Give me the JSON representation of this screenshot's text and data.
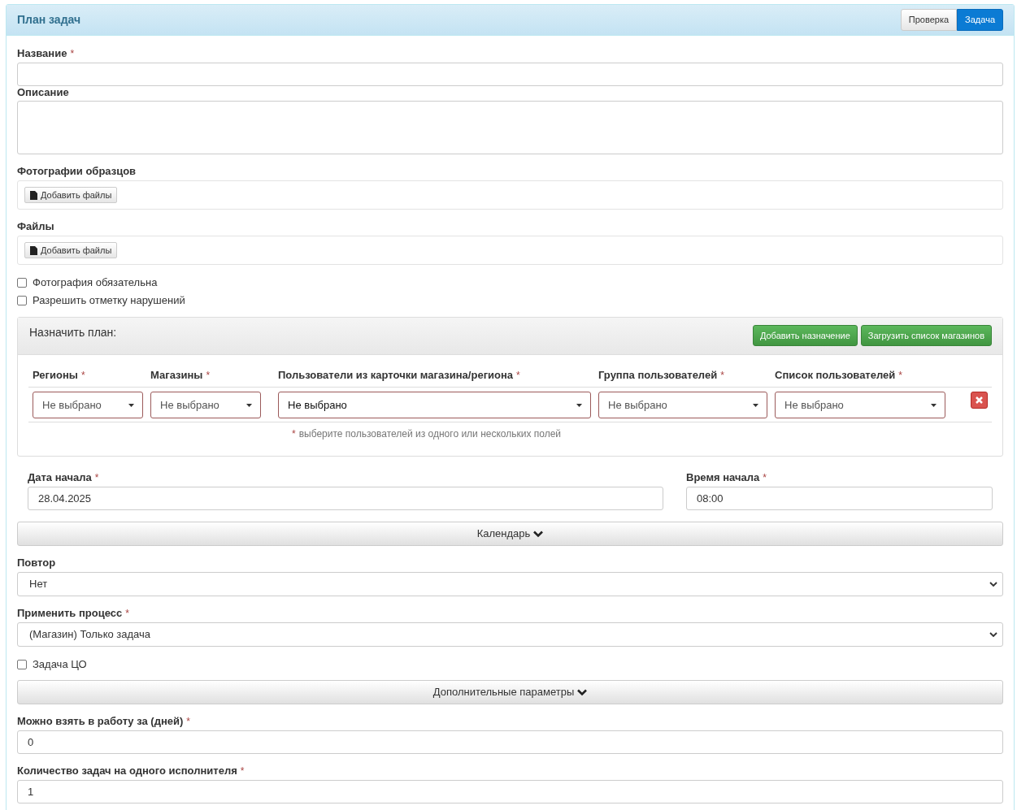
{
  "panel": {
    "title": "План задач",
    "tabs": [
      {
        "label": "Проверка",
        "selected": false
      },
      {
        "label": "Задача",
        "selected": true
      }
    ]
  },
  "sections": [
    {
      "kind": "text",
      "label": "Название",
      "mark": "*"
    },
    {
      "kind": "textarea",
      "label": "Описание"
    },
    {
      "kind": "files",
      "label": "Фотографии образцов",
      "button": "Добавить файлы"
    },
    {
      "kind": "files",
      "label": "Файлы",
      "button": "Добавить файлы"
    },
    {
      "kind": "checkbox",
      "label": "Фотография обязательна",
      "checked": false
    },
    {
      "kind": "checkbox",
      "label": "Разрешить отметку нарушений",
      "checked": false
    },
    {
      "kind": "plan",
      "title": "Назначить план:",
      "buttons": [
        "Добавить назначение",
        "Загрузить список магазинов"
      ],
      "columns": [
        {
          "label": "Регионы",
          "mark": "*"
        },
        {
          "label": "Магазины",
          "mark": "*"
        },
        {
          "label": "Пользователи из карточки магазина/региона",
          "mark": "*"
        },
        {
          "label": "Группа пользователей",
          "mark": "*"
        },
        {
          "label": "Список пользователей",
          "mark": "*"
        }
      ],
      "rows": [
        {
          "cells": [
            "Не выбрано",
            "Не выбрано",
            "Не выбрано",
            "Не выбрано",
            "Не выбрано"
          ]
        }
      ],
      "hint_mark": "*",
      "hint": "выберите пользователей из одного или нескольких полей"
    },
    {
      "kind": "pair",
      "items": [
        {
          "label": "Дата начала",
          "mark": "*",
          "value": "28.04.2025"
        },
        {
          "label": "Время начала",
          "mark": "*",
          "value": "08:00"
        }
      ]
    },
    {
      "kind": "expander",
      "label": "Календарь",
      "expanded": false
    },
    {
      "kind": "select",
      "label": "Повтор",
      "value": "Нет"
    },
    {
      "kind": "select",
      "label": "Применить процесс",
      "mark": "*",
      "value": "(Магазин) Только задача"
    },
    {
      "kind": "checkbox",
      "label": "Задача ЦО",
      "checked": false
    },
    {
      "kind": "expander",
      "label": "Дополнительные параметры",
      "expanded": false
    },
    {
      "kind": "text",
      "label": "Можно взять в работу за (дней)",
      "mark": "*",
      "value": "0"
    },
    {
      "kind": "text",
      "label": "Количество задач на одного исполнителя",
      "mark": "*",
      "value": "1"
    }
  ]
}
